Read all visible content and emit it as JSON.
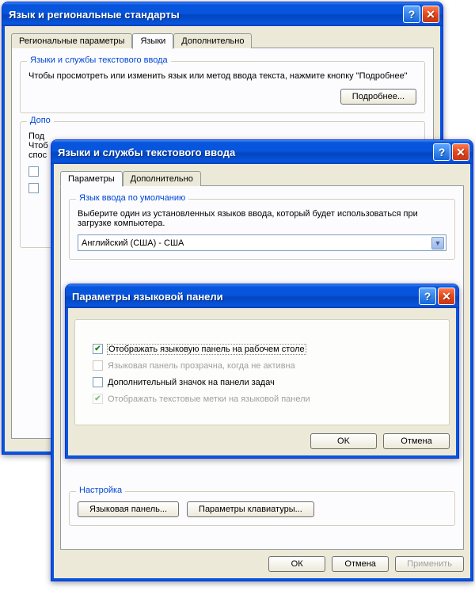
{
  "win1": {
    "title": "Язык и региональные стандарты",
    "tabs": {
      "regional": "Региональные параметры",
      "languages": "Языки",
      "advanced": "Дополнительно"
    },
    "group1": {
      "legend": "Языки и службы текстового ввода",
      "text": "Чтобы просмотреть или изменить язык или метод ввода текста, нажмите кнопку \"Подробнее\"",
      "details_btn": "Подробнее..."
    },
    "partial": {
      "dop_label": "Допо",
      "line1": "Под",
      "line2": "Чтоб",
      "line3": "спос"
    }
  },
  "win2": {
    "title": "Языки и службы текстового ввода",
    "tabs": {
      "params": "Параметры",
      "advanced": "Дополнительно"
    },
    "group_default": {
      "legend": "Язык ввода по умолчанию",
      "text": "Выберите один из установленных языков ввода, который будет использоваться при загрузке компьютера.",
      "select_value": "Английский (США) - США"
    },
    "group_settings": {
      "legend": "Настройка",
      "btn_langbar": "Языковая панель...",
      "btn_keyboard": "Параметры клавиатуры..."
    },
    "bottom": {
      "ok": "ОК",
      "cancel": "Отмена",
      "apply": "Применить"
    }
  },
  "win3": {
    "title": "Параметры языковой панели",
    "chk1": "Отображать языковую панель на рабочем столе",
    "chk2": "Языковая панель прозрачна, когда не активна",
    "chk3": "Дополнительный значок на панели задач",
    "chk4": "Отображать текстовые метки на языковой панели",
    "ok": "OK",
    "cancel": "Отмена"
  }
}
